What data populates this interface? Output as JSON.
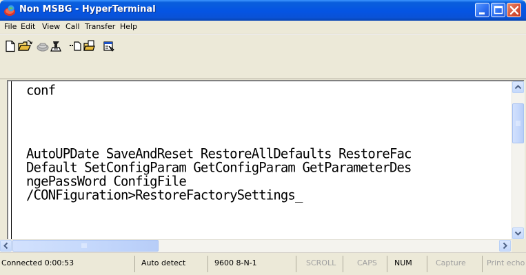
{
  "window": {
    "title": "Non MSBG - HyperTerminal",
    "app_icon": "hyperterminal-phone-icon",
    "controls": [
      "minimize-icon",
      "maximize-icon",
      "close-icon"
    ]
  },
  "menu": {
    "items": [
      {
        "label": "File"
      },
      {
        "label": "Edit"
      },
      {
        "label": "View"
      },
      {
        "label": "Call"
      },
      {
        "label": "Transfer"
      },
      {
        "label": "Help"
      }
    ]
  },
  "toolbar": {
    "buttons": [
      {
        "icon": "new-document-icon"
      },
      {
        "icon": "open-folder-icon"
      },
      {
        "icon": "connect-phone-icon"
      },
      {
        "icon": "disconnect-phone-icon"
      },
      {
        "icon": "send-icon"
      },
      {
        "icon": "receive-icon"
      },
      {
        "icon": "properties-icon"
      }
    ]
  },
  "terminal": {
    "lines": [
      "conf",
      "",
      "",
      "",
      "AutoUPDate SaveAndReset RestoreAllDefaults RestoreFac",
      "Default SetConfigParam GetConfigParam GetParameterDes",
      "ngePassWord ConfigFile",
      "/CONFiguration>RestoreFactorySettings"
    ],
    "cursor": "_"
  },
  "scrollbars": {
    "vertical": {
      "up_icon": "scroll-up-arrow-icon",
      "down_icon": "scroll-down-arrow-icon",
      "thumb_icon": "grip-icon"
    },
    "horizontal": {
      "left_icon": "scroll-left-arrow-icon",
      "right_icon": "scroll-right-arrow-icon",
      "thumb_icon": "grip-icon"
    }
  },
  "status": {
    "connected": "Connected 0:00:53",
    "detect": "Auto detect",
    "settings": "9600 8-N-1",
    "scroll": "SCROLL",
    "caps": "CAPS",
    "num": "NUM",
    "capture": "Capture",
    "print_echo": "Print echo"
  },
  "colors": {
    "titlebar": "#0554e3",
    "chrome": "#ece9d8",
    "terminal_bg": "#ffffff",
    "terminal_text": "#000000",
    "scroll_accent": "#c5d9fb"
  }
}
